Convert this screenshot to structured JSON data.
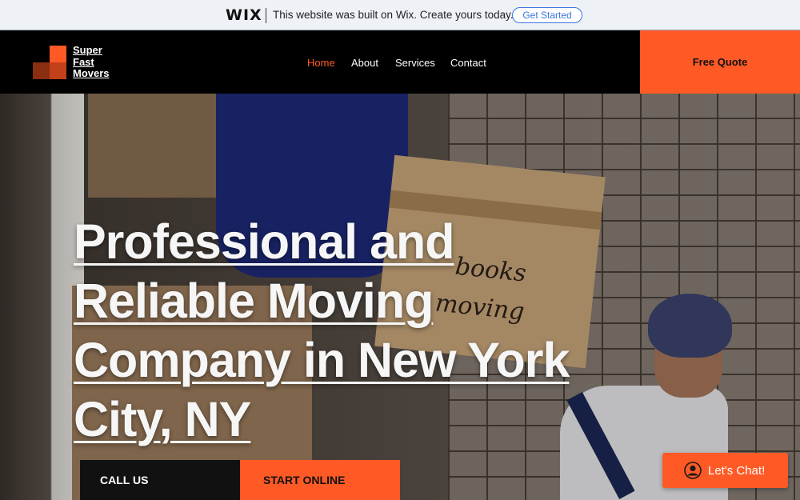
{
  "wix_banner": {
    "logo": "WIX",
    "message": "This website was built on Wix. Create yours today.",
    "cta_label": "Get Started"
  },
  "header": {
    "logo_lines": [
      "Super",
      "Fast",
      "Movers"
    ],
    "nav": [
      {
        "label": "Home",
        "active": true
      },
      {
        "label": "About",
        "active": false
      },
      {
        "label": "Services",
        "active": false
      },
      {
        "label": "Contact",
        "active": false
      }
    ],
    "quote_label": "Free Quote"
  },
  "hero": {
    "headline_lines": [
      "Professional and",
      "Reliable Moving",
      "Company in New York",
      "City, NY"
    ],
    "box_text": [
      "books",
      "moving"
    ],
    "call_label": "CALL US",
    "start_label": "START ONLINE"
  },
  "chat": {
    "label": "Let's Chat!",
    "icon": "user-icon"
  },
  "colors": {
    "accent": "#ff5a26",
    "header_bg": "#000000",
    "wix_link": "#3b74e0"
  }
}
